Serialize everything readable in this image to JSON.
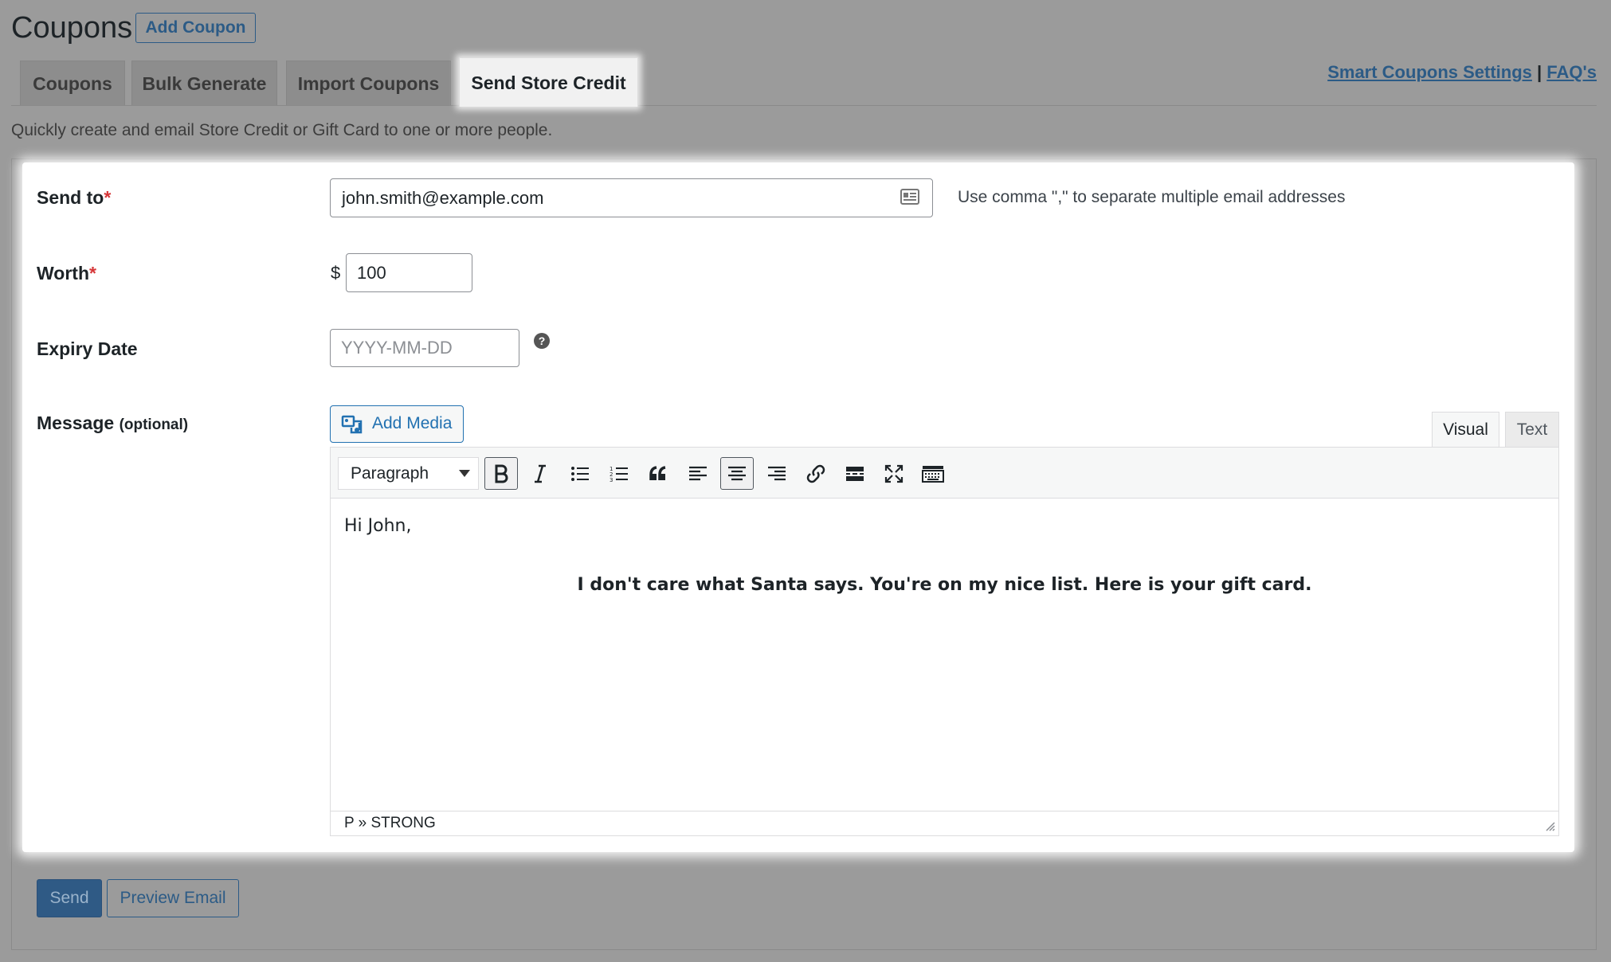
{
  "header": {
    "title": "Coupons",
    "add_coupon_label": "Add Coupon"
  },
  "tabs": [
    {
      "label": "Coupons",
      "active": false
    },
    {
      "label": "Bulk Generate",
      "active": false
    },
    {
      "label": "Import Coupons",
      "active": false
    },
    {
      "label": "Send Store Credit",
      "active": true
    }
  ],
  "top_links": {
    "settings": "Smart Coupons Settings",
    "separator": "|",
    "faq": "FAQ's"
  },
  "description": "Quickly create and email Store Credit or Gift Card to one or more people.",
  "form": {
    "send_to": {
      "label": "Send to",
      "required_mark": "*",
      "value": "john.smith@example.com",
      "hint": "Use comma \",\" to separate multiple email addresses"
    },
    "worth": {
      "label": "Worth",
      "required_mark": "*",
      "currency": "$",
      "value": "100"
    },
    "expiry": {
      "label": "Expiry Date",
      "placeholder": "YYYY-MM-DD",
      "help": "?"
    },
    "message": {
      "label": "Message",
      "optional": "(optional)"
    }
  },
  "editor": {
    "add_media_label": "Add Media",
    "mode_tabs": [
      "Visual",
      "Text"
    ],
    "active_mode": "Visual",
    "format_value": "Paragraph",
    "toolbar_icons": [
      "bold-icon",
      "italic-icon",
      "bullet-list-icon",
      "numbered-list-icon",
      "blockquote-icon",
      "align-left-icon",
      "align-center-icon",
      "align-right-icon",
      "link-icon",
      "read-more-icon",
      "fullscreen-icon",
      "toolbar-toggle-icon"
    ],
    "content_line1": "Hi John,",
    "content_line2": "I don't care what Santa says. You're on my nice list. Here is your gift card.",
    "status_path": "P » STRONG"
  },
  "actions": {
    "send_label": "Send",
    "preview_label": "Preview Email"
  },
  "colors": {
    "accent": "#2271b1",
    "required": "#d63638",
    "overlay": "#9b9b9b"
  }
}
